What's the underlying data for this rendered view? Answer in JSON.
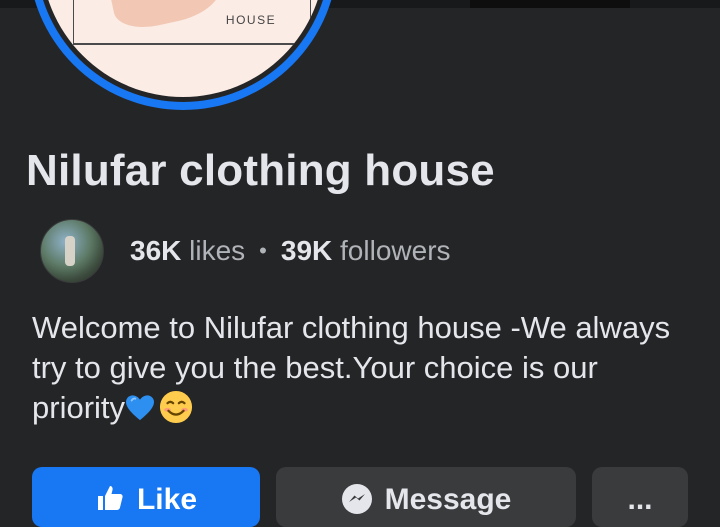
{
  "profile": {
    "logo_text": "HOUSE",
    "page_name": "Nilufar clothing house"
  },
  "stats": {
    "likes_count": "36K",
    "likes_label": "likes",
    "separator": "•",
    "followers_count": "39K",
    "followers_label": "followers"
  },
  "bio": {
    "text": "Welcome to Nilufar clothing house  -We always try to give you the best.Your choice is our priority",
    "emojis": [
      "blue-heart",
      "smiling-face"
    ]
  },
  "actions": {
    "like_label": "Like",
    "message_label": "Message",
    "more_label": "..."
  },
  "colors": {
    "background": "#242526",
    "accent": "#1877f2",
    "button_secondary": "#3a3b3c"
  }
}
